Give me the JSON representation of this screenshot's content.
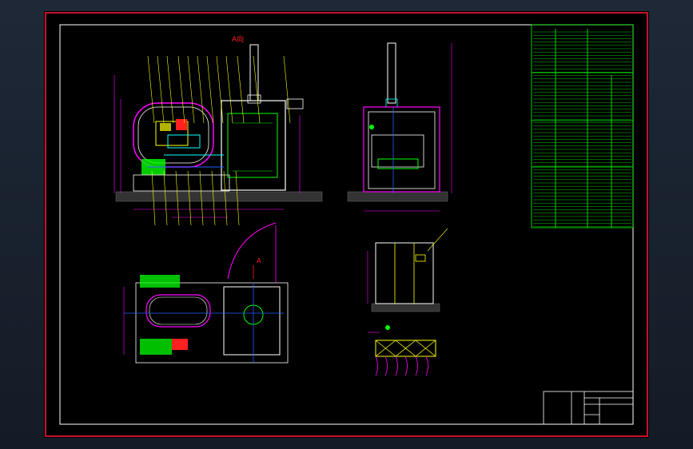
{
  "colors": {
    "background": "#1a2230",
    "sheet": "#000000",
    "frame_red": "#c8102e",
    "frame_white": "#ffffff",
    "line_yellow": "#ffff00",
    "line_cyan": "#00ffff",
    "line_green": "#00ff00",
    "line_magenta": "#ff00ff",
    "line_red": "#ff2020",
    "line_blue": "#2060ff",
    "line_white": "#ffffff"
  },
  "labels": {
    "view_a": "A向",
    "section_a": "A"
  }
}
